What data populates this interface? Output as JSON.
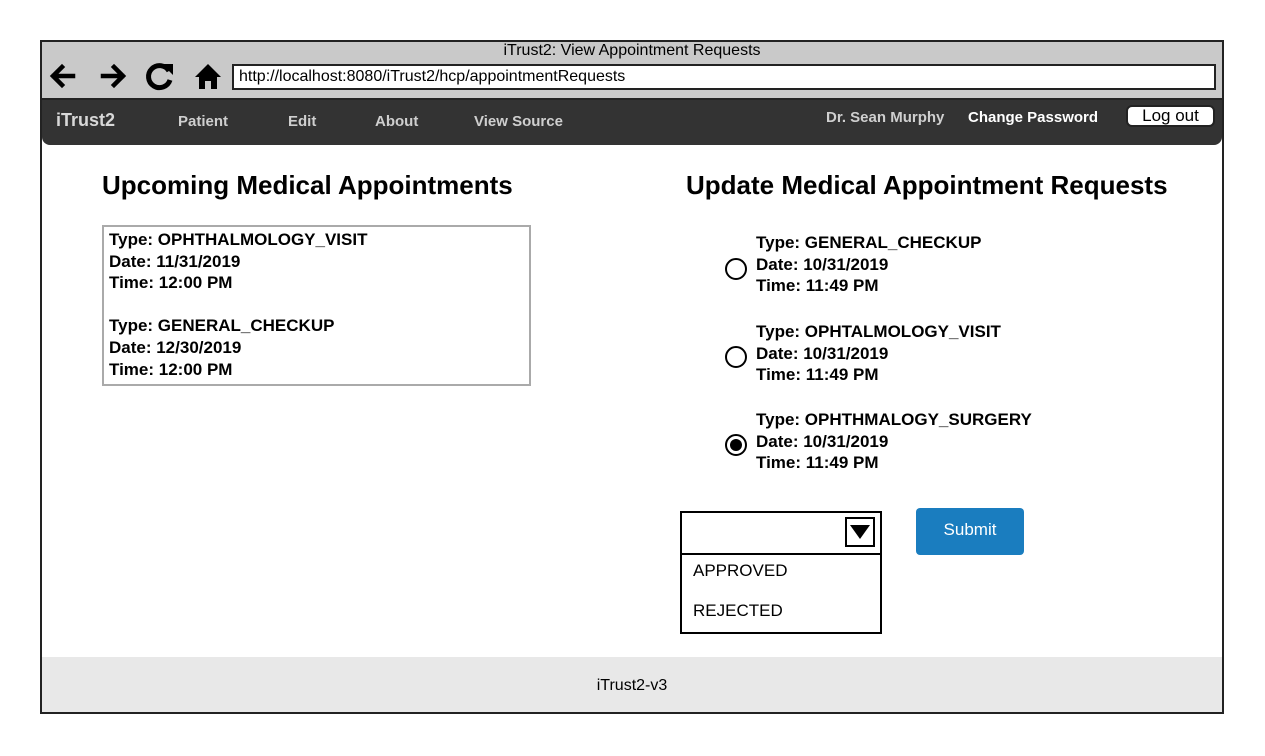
{
  "browser": {
    "window_title": "iTrust2: View Appointment Requests",
    "url": "http://localhost:8080/iTrust2/hcp/appointmentRequests",
    "icons": [
      "back-arrow-icon",
      "forward-arrow-icon",
      "reload-icon",
      "home-icon"
    ]
  },
  "navbar": {
    "brand": "iTrust2",
    "menu": [
      "Patient",
      "Edit",
      "About",
      "View Source"
    ],
    "user": "Dr. Sean Murphy",
    "change_password": "Change Password",
    "logout": "Log out"
  },
  "upcoming": {
    "heading": "Upcoming Medical Appointments",
    "appointments": [
      {
        "type": "Type: OPHTHALMOLOGY_VISIT",
        "date": "Date: 11/31/2019",
        "time": "Time: 12:00 PM"
      },
      {
        "type": "Type: GENERAL_CHECKUP",
        "date": "Date: 12/30/2019",
        "time": "Time: 12:00 PM"
      }
    ]
  },
  "requests": {
    "heading": "Update Medical Appointment Requests",
    "items": [
      {
        "type": "Type: GENERAL_CHECKUP",
        "date": "Date: 10/31/2019",
        "time": "Time: 11:49 PM",
        "selected": false
      },
      {
        "type": "Type: OPHTALMOLOGY_VISIT",
        "date": "Date: 10/31/2019",
        "time": "Time: 11:49 PM",
        "selected": false
      },
      {
        "type": "Type: OPHTHMALOGY_SURGERY",
        "date": "Date: 10/31/2019",
        "time": "Time: 11:49 PM",
        "selected": true
      }
    ],
    "status_select": {
      "selected_value": "",
      "options": [
        "APPROVED",
        "REJECTED"
      ]
    },
    "submit_label": "Submit",
    "submit_color": "#1a7dbf"
  },
  "footer": {
    "text": "iTrust2-v3"
  }
}
